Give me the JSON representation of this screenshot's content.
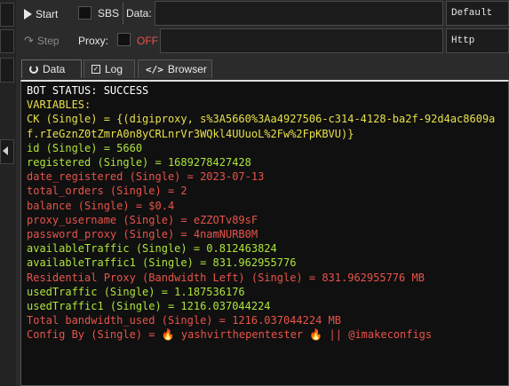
{
  "toolbar": {
    "start_label": "Start",
    "sbs_label": "SBS",
    "data_label": "Data:",
    "data_value": "",
    "data_select": "Default",
    "step_label": "Step",
    "proxy_label": "Proxy:",
    "proxy_state": "OFF",
    "proxy_value": "",
    "proxy_select": "Http"
  },
  "tabs": [
    {
      "label": "Data",
      "icon": "circle-arrow-icon"
    },
    {
      "label": "Log",
      "icon": "checkbox-icon"
    },
    {
      "label": "Browser",
      "icon": "code-icon"
    }
  ],
  "colors": {
    "white": "#ffffff",
    "yellow": "#e8e04a",
    "green": "#aee63c",
    "red": "#e8534a",
    "proxy_off": "#e8534a"
  },
  "output": [
    {
      "text": "BOT STATUS: SUCCESS",
      "color": "white"
    },
    {
      "text": "VARIABLES:",
      "color": "yellow"
    },
    {
      "text": "CK (Single) = {(digiproxy, s%3A5660%3Aa4927506-c314-4128-ba2f-92d4ac8609af.rIeGznZ0tZmrA0n8yCRLnrVr3WQkl4UUuoL%2Fw%2FpKBVU)}",
      "color": "yellow",
      "wrap": true
    },
    {
      "text": "id (Single) = 5660",
      "color": "green"
    },
    {
      "text": "registered (Single) = 1689278427428",
      "color": "green"
    },
    {
      "text": "date_registered (Single) = 2023-07-13",
      "color": "red"
    },
    {
      "text": "total_orders (Single) = 2",
      "color": "red"
    },
    {
      "text": "balance (Single) = $0.4",
      "color": "red"
    },
    {
      "text": "proxy_username (Single) = eZZOTv89sF",
      "color": "red"
    },
    {
      "text": "password_proxy (Single) = 4namNURB0M",
      "color": "red"
    },
    {
      "text": "availableTraffic (Single) = 0.812463824",
      "color": "green"
    },
    {
      "text": "availableTraffic1 (Single) = 831.962955776",
      "color": "green"
    },
    {
      "text": "Residential Proxy (Bandwidth Left) (Single) = 831.962955776 MB",
      "color": "red"
    },
    {
      "text": "usedTraffic (Single) = 1.187536176",
      "color": "green"
    },
    {
      "text": "usedTraffic1 (Single) = 1216.037044224",
      "color": "green"
    },
    {
      "text": "Total bandwidth_used (Single) = 1216.037044224 MB",
      "color": "red"
    },
    {
      "text": "Config By  (Single) = 🔥 yashvirthepentester 🔥 || @imakeconfigs",
      "color": "red"
    }
  ]
}
